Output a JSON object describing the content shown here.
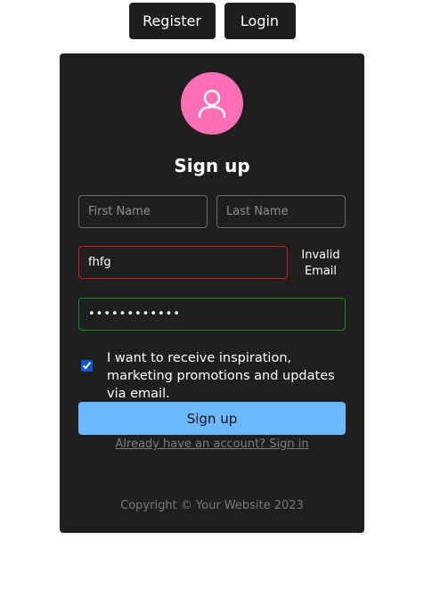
{
  "nav": {
    "register_label": "Register",
    "login_label": "Login"
  },
  "form": {
    "title": "Sign up",
    "first_name": {
      "placeholder": "First Name",
      "value": ""
    },
    "last_name": {
      "placeholder": "Last Name",
      "value": ""
    },
    "email": {
      "value": "fhfg",
      "error": "Invalid Email"
    },
    "password": {
      "value": "••••••••••••"
    },
    "marketing_checkbox": {
      "checked": true,
      "label": "I want to receive inspiration, marketing promotions and updates via email."
    },
    "submit_label": "Sign up",
    "signin_link": "Already have an account? Sign in"
  },
  "footer": {
    "copyright": "Copyright © Your Website 2023"
  },
  "colors": {
    "page_bg": "#ffffff",
    "card_bg": "#1f1f1f",
    "avatar_bg": "#ff6fb6",
    "submit_bg": "#6cb8ff",
    "error_border": "#d41a1a",
    "valid_border": "#1a8a2a"
  },
  "icons": {
    "avatar": "person-icon"
  }
}
